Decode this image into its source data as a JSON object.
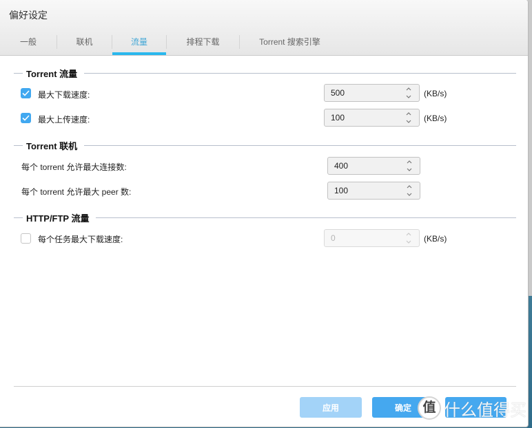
{
  "dialog": {
    "title": "偏好设定"
  },
  "tabs": [
    {
      "label": "一般",
      "active": false
    },
    {
      "label": "联机",
      "active": false
    },
    {
      "label": "流量",
      "active": true
    },
    {
      "label": "排程下载",
      "active": false
    },
    {
      "label": "Torrent 搜索引擎",
      "active": false
    }
  ],
  "sections": {
    "torrent_traffic": {
      "title": "Torrent 流量",
      "max_download": {
        "label": "最大下载速度:",
        "checked": true,
        "value": "500",
        "unit": "(KB/s)"
      },
      "max_upload": {
        "label": "最大上传速度:",
        "checked": true,
        "value": "100",
        "unit": "(KB/s)"
      }
    },
    "torrent_connection": {
      "title": "Torrent 联机",
      "max_connections": {
        "label": "每个 torrent 允许最大连接数:",
        "value": "400"
      },
      "max_peers": {
        "label": "每个 torrent 允许最大 peer 数:",
        "value": "100"
      }
    },
    "http_ftp_traffic": {
      "title": "HTTP/FTP 流量",
      "max_task_download": {
        "label": "每个任务最大下载速度:",
        "checked": false,
        "value": "0",
        "unit": "(KB/s)",
        "disabled": true
      }
    }
  },
  "footer": {
    "apply_label": "应用",
    "ok_label": "确定",
    "cancel_label": ""
  },
  "watermark": {
    "badge": "值",
    "text": "什么值得买"
  },
  "colors": {
    "accent": "#2ab8ee",
    "checkbox": "#41a8f0",
    "button": "#45a8ef",
    "button_disabled": "#a3d3f8"
  }
}
